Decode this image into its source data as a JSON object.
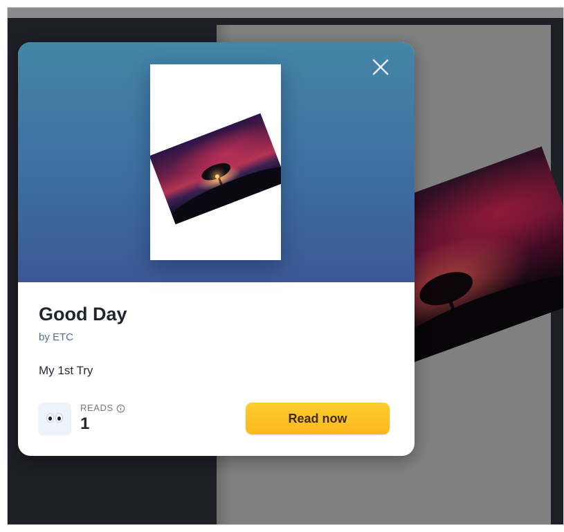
{
  "story": {
    "title": "Good Day",
    "author": "by ETC",
    "description": "My 1st Try"
  },
  "stats": {
    "reads_label": "READS",
    "reads_count": "1",
    "reads_icon": "eyes-icon",
    "info_icon": "info-icon"
  },
  "actions": {
    "read_now_label": "Read now",
    "close_icon": "close-icon"
  },
  "colors": {
    "hero_top": "#4486a6",
    "hero_bottom": "#3b5895",
    "button": "#fbb81f",
    "backdrop": "#1e1f27"
  }
}
